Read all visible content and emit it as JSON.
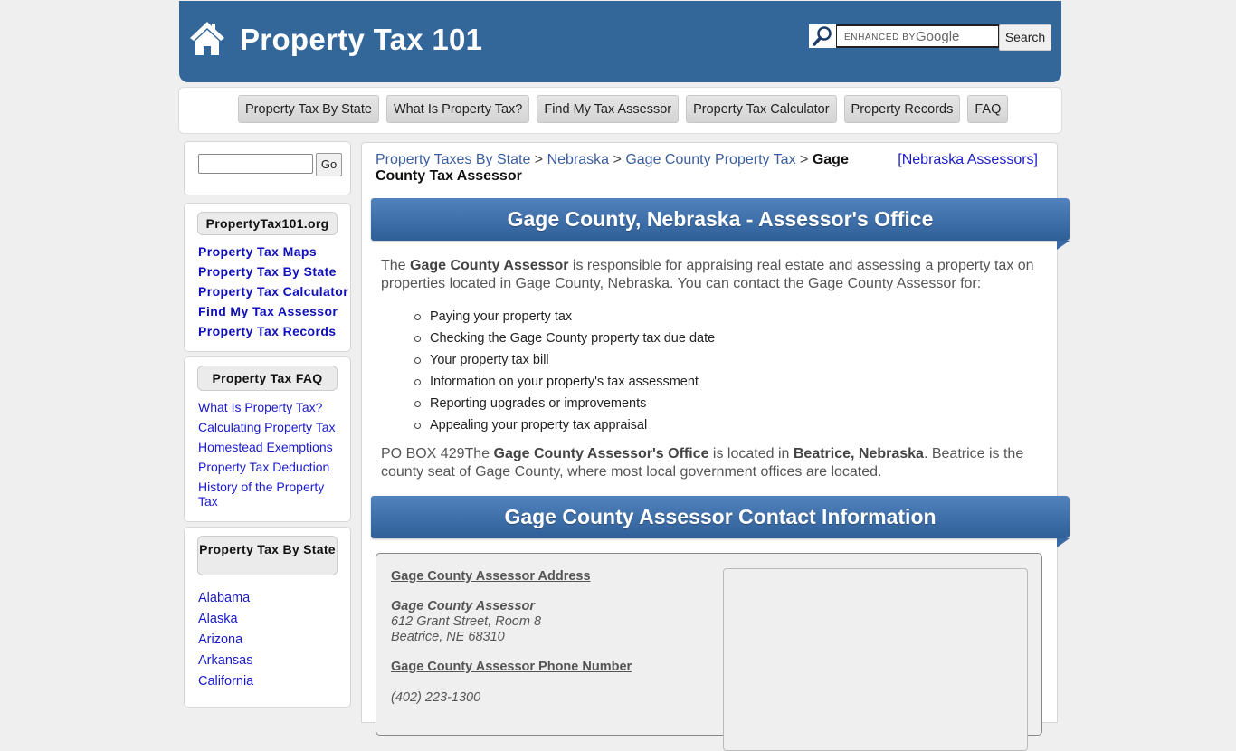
{
  "header": {
    "title": "Property Tax 101",
    "search": {
      "placeholder_prefix": "ENHANCED BY",
      "placeholder_brand": "Google",
      "button_label": "Search"
    }
  },
  "nav": {
    "items": [
      {
        "label": "Property Tax By State"
      },
      {
        "label": "What Is Property Tax?"
      },
      {
        "label": "Find My Tax Assessor"
      },
      {
        "label": "Property Tax Calculator"
      },
      {
        "label": "Property Records"
      },
      {
        "label": "FAQ"
      }
    ]
  },
  "sidebar": {
    "search": {
      "value": "",
      "button_label": "Go"
    },
    "org": {
      "heading": "PropertyTax101.org",
      "links": [
        {
          "label": "Property Tax Maps"
        },
        {
          "label": "Property Tax By State"
        },
        {
          "label": "Property Tax Calculator"
        },
        {
          "label": "Find My Tax Assessor"
        },
        {
          "label": "Property Tax Records"
        }
      ]
    },
    "faq": {
      "heading": "Property Tax FAQ",
      "links": [
        {
          "label": "What Is Property Tax?"
        },
        {
          "label": "Calculating Property Tax"
        },
        {
          "label": "Homestead Exemptions"
        },
        {
          "label": "Property Tax Deduction"
        },
        {
          "label": "History of the Property Tax"
        }
      ]
    },
    "states": {
      "heading": "Property Tax By State",
      "links": [
        {
          "label": "Alabama"
        },
        {
          "label": "Alaska"
        },
        {
          "label": "Arizona"
        },
        {
          "label": "Arkansas"
        },
        {
          "label": "California"
        }
      ]
    }
  },
  "breadcrumb": {
    "items": [
      {
        "label": "Property Taxes By State"
      },
      {
        "label": "Nebraska"
      },
      {
        "label": "Gage County Property Tax"
      }
    ],
    "separator": ">",
    "current": "Gage County Tax Assessor",
    "state_assessors_link": "[Nebraska Assessors]"
  },
  "main": {
    "banner1": "Gage County, Nebraska - Assessor's Office",
    "intro": {
      "pre": "The ",
      "bold": "Gage County Assessor",
      "post": " is responsible for appraising real estate and assessing a property tax on properties located in Gage County, Nebraska. You can contact the Gage County Assessor for:"
    },
    "bullets": [
      "Paying your property tax",
      "Checking the Gage County property tax due date",
      "Your property tax bill",
      "Information on your property's tax assessment",
      "Reporting upgrades or improvements",
      "Appealing your property tax appraisal"
    ],
    "location": {
      "p1": "PO BOX 429The ",
      "b1": "Gage County Assessor's Office",
      "p2": " is located in ",
      "b2": "Beatrice, Nebraska",
      "p3": ". Beatrice is the county seat of Gage County, where most local government offices are located."
    },
    "banner2": "Gage County Assessor Contact Information",
    "contact": {
      "address_heading": "Gage County Assessor Address",
      "office_name": "Gage County Assessor",
      "street": "612 Grant Street, Room 8",
      "city_line": "Beatrice, NE 68310",
      "phone_heading": "Gage County Assessor Phone Number",
      "phone": "(402) 223-1300"
    }
  },
  "colors": {
    "brand_blue": "#336699",
    "link_blue": "#1a1acc",
    "breadcrumb_link": "#3c5e9e"
  }
}
